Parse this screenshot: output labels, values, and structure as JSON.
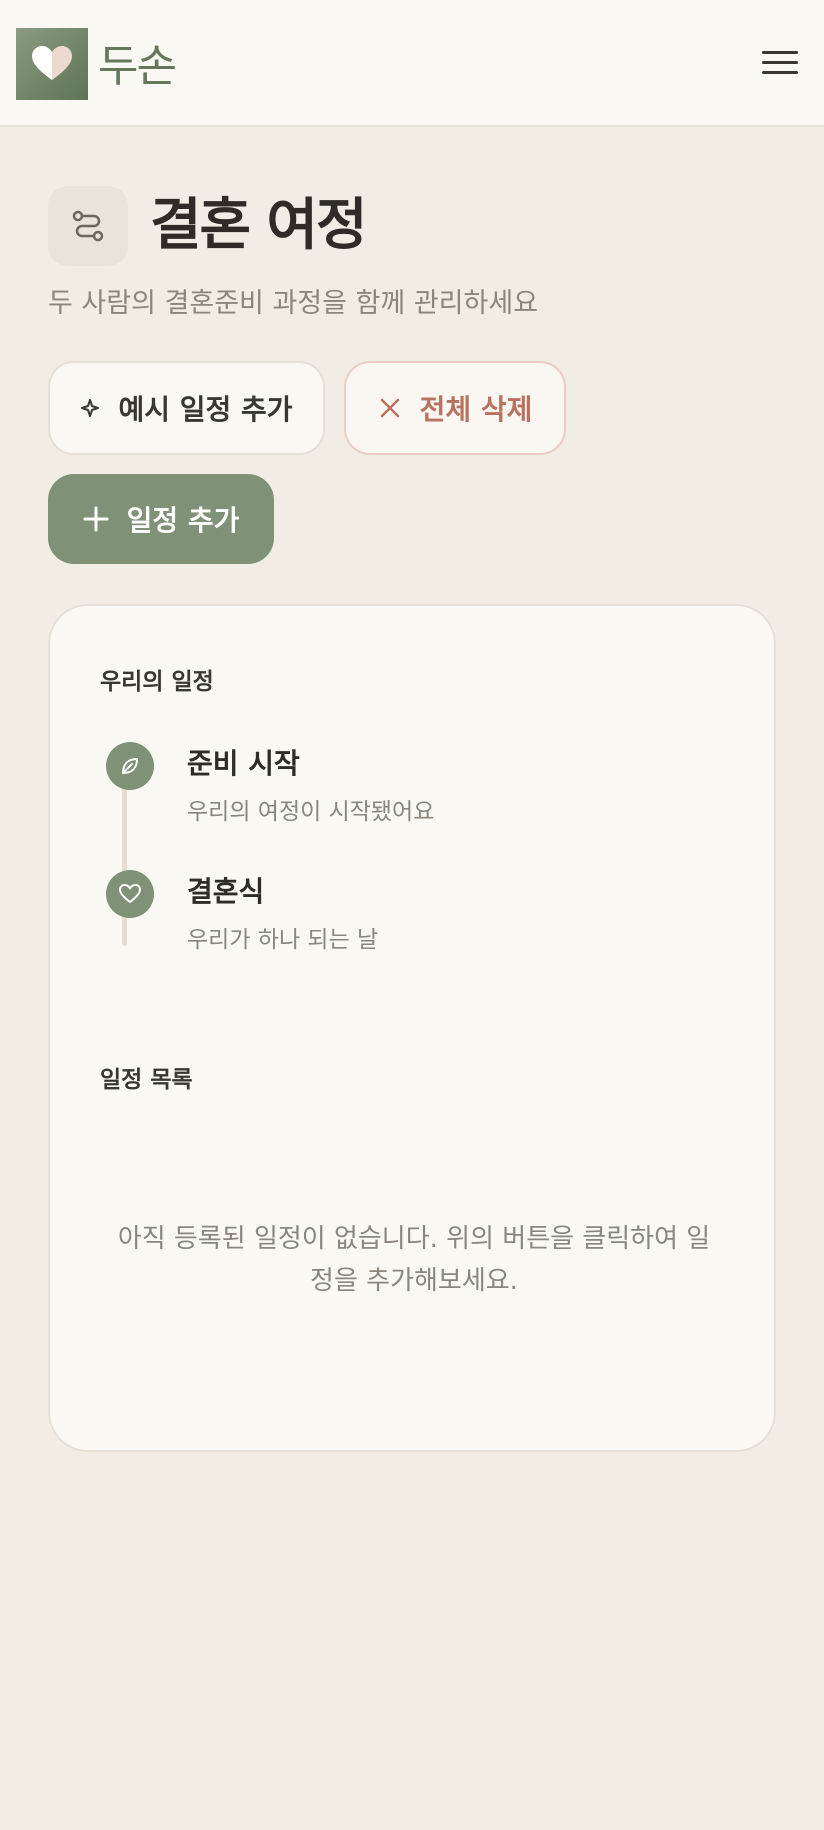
{
  "header": {
    "logo_text": "두손",
    "logo_icon": "heart-icon",
    "menu_icon": "hamburger-icon"
  },
  "page": {
    "title": "결혼 여정",
    "title_icon": "route-icon",
    "subtitle": "두 사람의 결혼준비 과정을 함께 관리하세요"
  },
  "actions": {
    "example_label": "예시 일정 추가",
    "example_icon": "sparkle-icon",
    "delete_label": "전체 삭제",
    "delete_icon": "close-icon",
    "add_label": "일정 추가",
    "add_icon": "plus-icon"
  },
  "timeline": {
    "title": "우리의 일정",
    "items": [
      {
        "title": "준비 시작",
        "desc": "우리의 여정이 시작됐어요",
        "icon": "leaf-icon"
      },
      {
        "title": "결혼식",
        "desc": "우리가 하나 되는 날",
        "icon": "heart-icon"
      }
    ]
  },
  "schedule_list": {
    "title": "일정 목록",
    "empty_message": "아직 등록된 일정이 없습니다. 위의 버튼을 클릭하여 일정을 추가해보세요."
  },
  "colors": {
    "background": "#f1ece4",
    "surface": "#faf8f3",
    "accent": "#7f9277",
    "danger": "#b8725f",
    "text": "#2f2c28",
    "muted": "#8a857d"
  }
}
